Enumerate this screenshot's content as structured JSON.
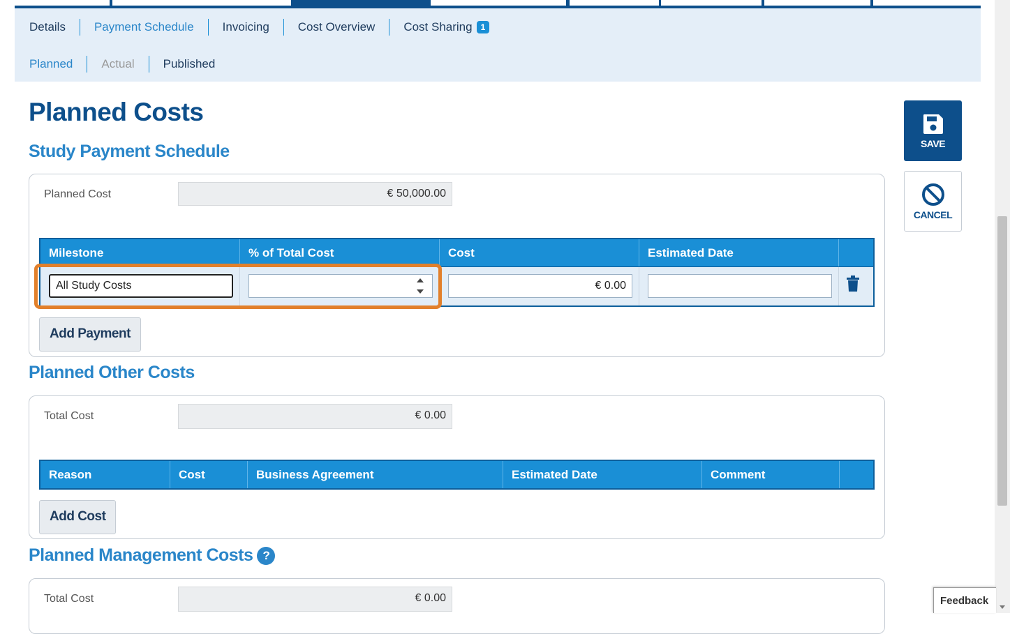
{
  "tabs": [
    {
      "label": "Details",
      "active": false
    },
    {
      "label": "Payment Schedule",
      "active": true
    },
    {
      "label": "Invoicing",
      "active": false
    },
    {
      "label": "Cost Overview",
      "active": false
    },
    {
      "label": "Cost Sharing",
      "active": false,
      "badge": "1"
    }
  ],
  "subtabs": [
    {
      "label": "Planned",
      "state": "active"
    },
    {
      "label": "Actual",
      "state": "disabled"
    },
    {
      "label": "Published",
      "state": "normal"
    }
  ],
  "page_title": "Planned Costs",
  "study_schedule": {
    "title": "Study Payment Schedule",
    "planned_cost_label": "Planned Cost",
    "planned_cost_value": "€ 50,000.00",
    "columns": [
      "Milestone",
      "% of Total Cost",
      "Cost",
      "Estimated Date"
    ],
    "row": {
      "milestone": "All Study Costs",
      "percent": "",
      "cost": "€ 0.00",
      "estimated_date": ""
    },
    "add_button": "Add Payment"
  },
  "other_costs": {
    "title": "Planned Other Costs",
    "total_label": "Total Cost",
    "total_value": "€ 0.00",
    "columns": [
      "Reason",
      "Cost",
      "Business Agreement",
      "Estimated Date",
      "Comment"
    ],
    "add_button": "Add Cost"
  },
  "management_costs": {
    "title": "Planned Management Costs",
    "help": "?",
    "total_label": "Total Cost",
    "total_value": "€ 0.00"
  },
  "actions": {
    "save_label": "SAVE",
    "cancel_label": "CANCEL"
  },
  "feedback_label": "Feedback",
  "colors": {
    "primary": "#0d4f8b",
    "accent": "#1a8fd6",
    "highlight": "#e2802b"
  }
}
